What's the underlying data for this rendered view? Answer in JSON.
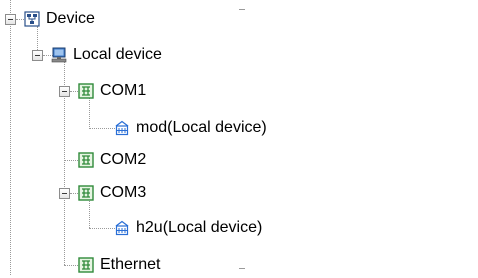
{
  "tree": {
    "root": {
      "label": "Device",
      "icon": "network-device-icon"
    },
    "local_device": {
      "label": "Local device",
      "icon": "computer-icon"
    },
    "com1": {
      "label": "COM1",
      "icon": "serial-port-icon"
    },
    "com1_child": {
      "label": "mod(Local device)",
      "icon": "station-icon"
    },
    "com2": {
      "label": "COM2",
      "icon": "serial-port-icon"
    },
    "com3": {
      "label": "COM3",
      "icon": "serial-port-icon"
    },
    "com3_child": {
      "label": "h2u(Local device)",
      "icon": "station-icon"
    },
    "ethernet": {
      "label": "Ethernet",
      "icon": "serial-port-icon"
    }
  },
  "colors": {
    "port_icon": "#2f8a3a",
    "station_icon": "#2a6fd6",
    "computer_icon": "#3b78c8",
    "tree_line": "#9a9a9a"
  }
}
